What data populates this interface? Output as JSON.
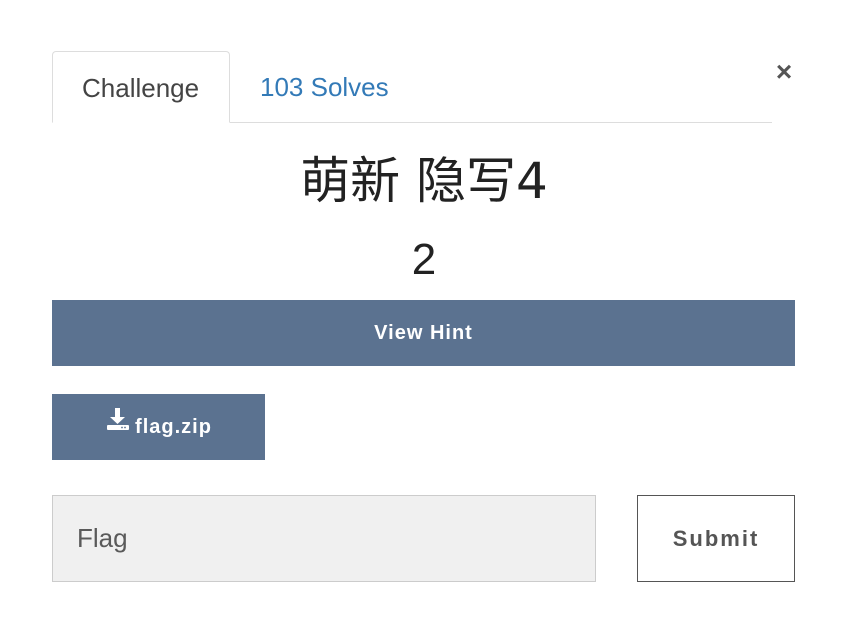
{
  "tabs": [
    {
      "label": "Challenge",
      "active": true
    },
    {
      "label": "103 Solves",
      "active": false
    }
  ],
  "close_label": "×",
  "challenge": {
    "name": "萌新 隐写4",
    "points": "2"
  },
  "hint_button": {
    "label": "View Hint"
  },
  "file": {
    "name": "flag.zip",
    "icon": "download-icon"
  },
  "flag_input": {
    "placeholder": "Flag",
    "value": ""
  },
  "submit_button": {
    "label": "Submit"
  },
  "colors": {
    "button_bg": "#5b7290",
    "link": "#337ab7",
    "input_bg": "#f0f0f0"
  }
}
